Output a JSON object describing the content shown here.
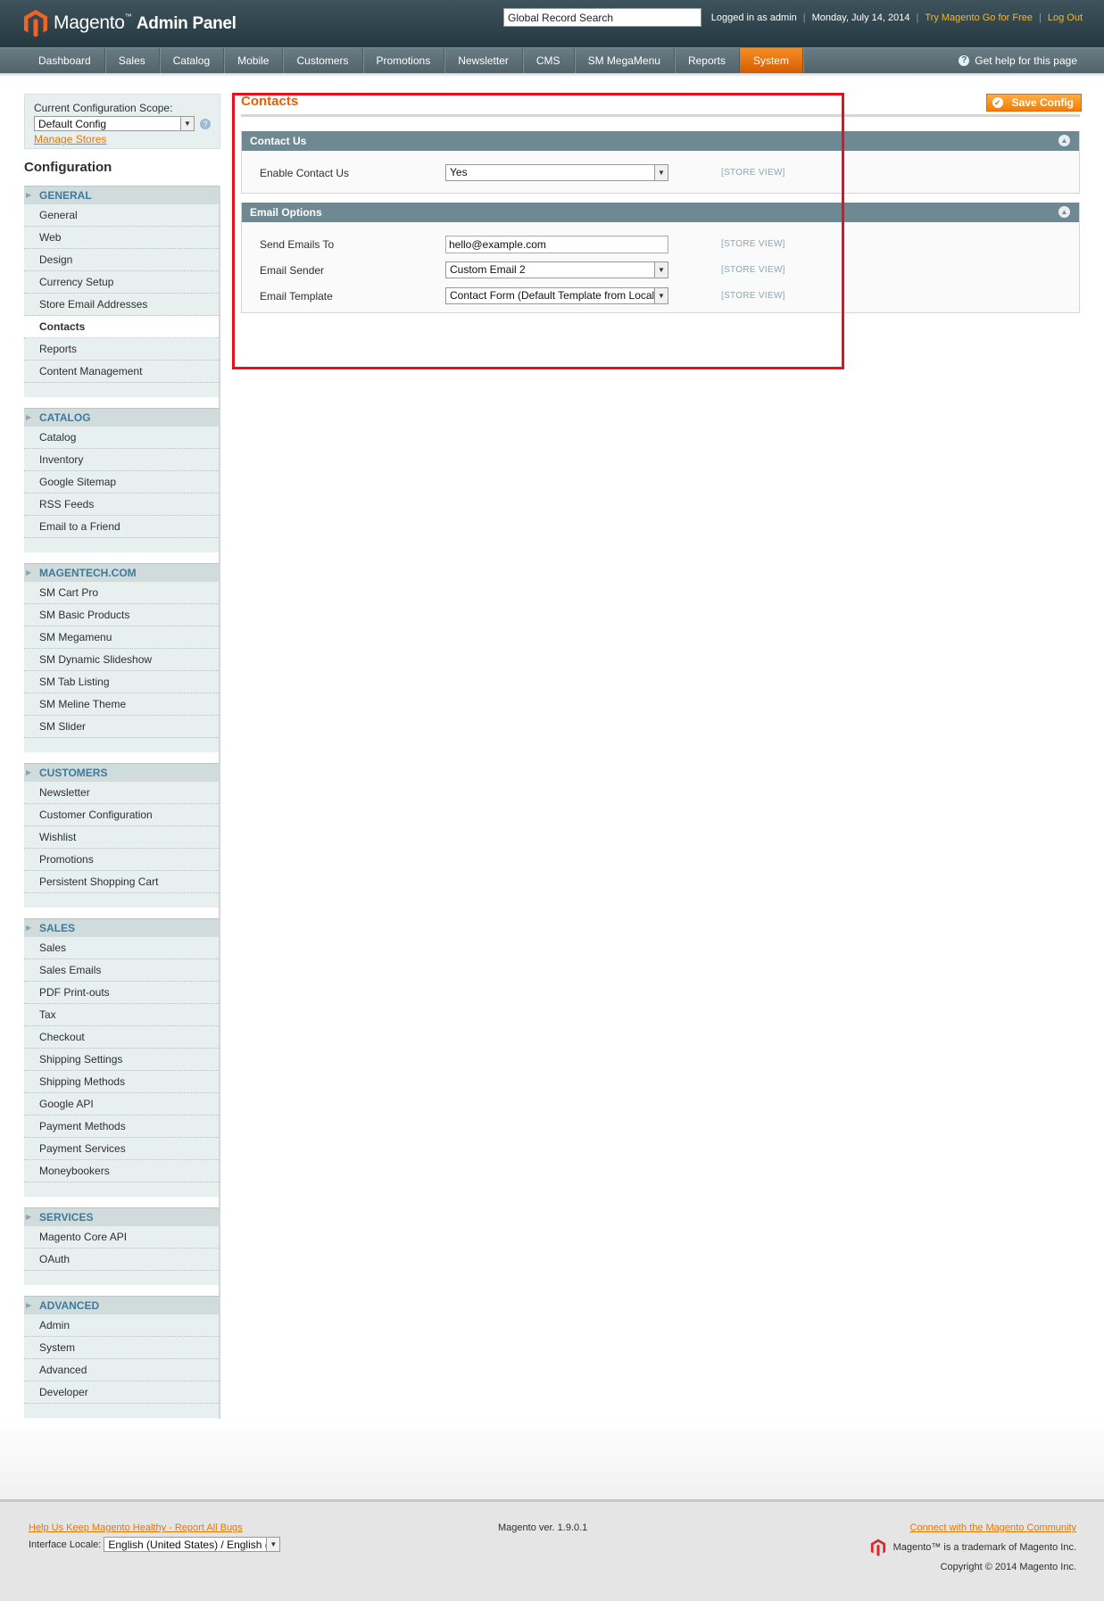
{
  "header": {
    "logo_brand": "Magento",
    "logo_suffix": "Admin Panel",
    "search_placeholder": "Global Record Search",
    "logged_in": "Logged in as admin",
    "date": "Monday, July 14, 2014",
    "try_link": "Try Magento Go for Free",
    "logout": "Log Out"
  },
  "nav": {
    "items": [
      "Dashboard",
      "Sales",
      "Catalog",
      "Mobile",
      "Customers",
      "Promotions",
      "Newsletter",
      "CMS",
      "SM MegaMenu",
      "Reports",
      "System"
    ],
    "active": "System",
    "help": "Get help for this page"
  },
  "sidebar": {
    "scope_label": "Current Configuration Scope:",
    "scope_value": "Default Config",
    "manage_stores": "Manage Stores",
    "title": "Configuration",
    "groups": [
      {
        "title": "GENERAL",
        "items": [
          "General",
          "Web",
          "Design",
          "Currency Setup",
          "Store Email Addresses",
          "Contacts",
          "Reports",
          "Content Management"
        ]
      },
      {
        "title": "CATALOG",
        "items": [
          "Catalog",
          "Inventory",
          "Google Sitemap",
          "RSS Feeds",
          "Email to a Friend"
        ]
      },
      {
        "title": "MAGENTECH.COM",
        "items": [
          "SM Cart Pro",
          "SM Basic Products",
          "SM Megamenu",
          "SM Dynamic Slideshow",
          "SM Tab Listing",
          "SM Meline Theme",
          "SM Slider"
        ]
      },
      {
        "title": "CUSTOMERS",
        "items": [
          "Newsletter",
          "Customer Configuration",
          "Wishlist",
          "Promotions",
          "Persistent Shopping Cart"
        ]
      },
      {
        "title": "SALES",
        "items": [
          "Sales",
          "Sales Emails",
          "PDF Print-outs",
          "Tax",
          "Checkout",
          "Shipping Settings",
          "Shipping Methods",
          "Google API",
          "Payment Methods",
          "Payment Services",
          "Moneybookers"
        ]
      },
      {
        "title": "SERVICES",
        "items": [
          "Magento Core API",
          "OAuth"
        ]
      },
      {
        "title": "ADVANCED",
        "items": [
          "Admin",
          "System",
          "Advanced",
          "Developer"
        ]
      }
    ],
    "active_item": "Contacts"
  },
  "main": {
    "title": "Contacts",
    "save_label": "Save Config",
    "contact_us": {
      "title": "Contact Us",
      "enable_label": "Enable Contact Us",
      "enable_value": "Yes",
      "scope": "[STORE VIEW]"
    },
    "email_options": {
      "title": "Email Options",
      "send_to_label": "Send Emails To",
      "send_to_value": "hello@example.com",
      "sender_label": "Email Sender",
      "sender_value": "Custom Email 2",
      "template_label": "Email Template",
      "template_value": "Contact Form (Default Template from Locale)",
      "scope": "[STORE VIEW]"
    }
  },
  "footer": {
    "report_bugs": "Help Us Keep Magento Healthy - Report All Bugs",
    "locale_label": "Interface Locale:",
    "locale_value": "English (United States) / English (",
    "version": "Magento ver. 1.9.0.1",
    "community": "Connect with the Magento Community",
    "trademark": "Magento™ is a trademark of Magento Inc.",
    "copyright": "Copyright © 2014 Magento Inc."
  },
  "colors": {
    "accent": "#eb5e00",
    "highlight": "#e8101b",
    "header": "#2f434b",
    "section_head": "#6f8992"
  }
}
